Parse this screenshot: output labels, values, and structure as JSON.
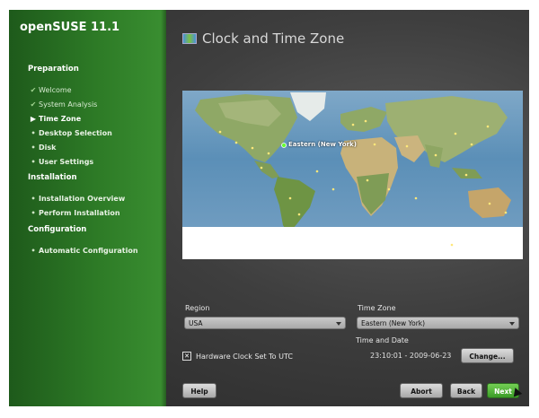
{
  "sidebar": {
    "brand": "openSUSE 11.1",
    "sections": [
      {
        "title": "Preparation",
        "steps": [
          {
            "label": "Welcome",
            "state": "done"
          },
          {
            "label": "System Analysis",
            "state": "done"
          },
          {
            "label": "Time Zone",
            "state": "current"
          },
          {
            "label": "Desktop Selection",
            "state": "todo"
          },
          {
            "label": "Disk",
            "state": "todo"
          },
          {
            "label": "User Settings",
            "state": "todo"
          }
        ]
      },
      {
        "title": "Installation",
        "steps": [
          {
            "label": "Installation Overview",
            "state": "todo"
          },
          {
            "label": "Perform Installation",
            "state": "todo"
          }
        ]
      },
      {
        "title": "Configuration",
        "steps": [
          {
            "label": "Automatic Configuration",
            "state": "todo"
          }
        ]
      }
    ]
  },
  "header": {
    "title": "Clock and Time Zone",
    "icon": "clock-map-icon"
  },
  "map": {
    "selected_label": "Eastern (New York)"
  },
  "form": {
    "region_label": "Region",
    "region_value": "USA",
    "timezone_label": "Time Zone",
    "timezone_value": "Eastern (New York)",
    "time_date_label": "Time and Date",
    "time_date_value": "23:10:01 - 2009-06-23",
    "change_button": "Change...",
    "hwclock_label": "Hardware Clock Set To UTC",
    "hwclock_checked": "✕"
  },
  "buttons": {
    "help": "Help",
    "abort": "Abort",
    "back": "Back",
    "next": "Next"
  },
  "colors": {
    "sidebar_green": "#2d7a26",
    "next_green": "#4caf34",
    "dark_bg": "#3e3e3e"
  }
}
